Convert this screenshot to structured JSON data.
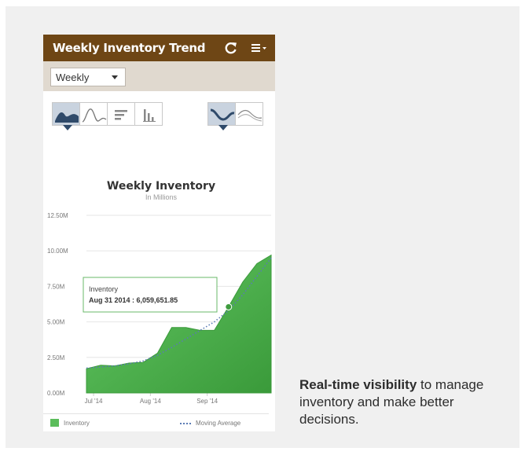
{
  "app": {
    "title": "Weekly Inventory Trend",
    "refresh_icon": "refresh-icon",
    "menu_icon": "hamburger-menu-icon"
  },
  "filter": {
    "selected": "Weekly"
  },
  "chart_types": [
    "area-chart-icon",
    "line-chart-icon",
    "horizontal-bar-chart-icon",
    "column-chart-icon"
  ],
  "chart_modes": [
    "filled-trend-icon",
    "line-trend-icon"
  ],
  "colors": {
    "header": "#6e4615",
    "filterbar": "#e0d9cf",
    "area_top": "#5fc35f",
    "area_bottom": "#3a9a3a",
    "moving_average": "#5a7bb5"
  },
  "chart_data": {
    "type": "area",
    "title": "Weekly Inventory",
    "subtitle": "In Millions",
    "ylim": [
      0,
      12500000
    ],
    "y_ticks": [
      "0.00M",
      "2.50M",
      "5.00M",
      "7.50M",
      "10.00M",
      "12.50M"
    ],
    "x_ticks": [
      "Jul '14",
      "Aug '14",
      "Sep '14"
    ],
    "x_tick_positions": [
      0.5,
      4.5,
      8.5
    ],
    "series": [
      {
        "name": "Inventory",
        "values": [
          1700000,
          1950000,
          1900000,
          2100000,
          2150000,
          2800000,
          4600000,
          4600000,
          4400000,
          4400000,
          6059651.85,
          7800000,
          9100000,
          9700000
        ]
      },
      {
        "name": "Moving Average",
        "values": [
          1750000,
          1820000,
          1900000,
          2050000,
          2250000,
          2650000,
          3200000,
          3800000,
          4400000,
          5000000,
          5800000,
          6900000,
          8200000,
          9500000
        ]
      }
    ],
    "tooltip": {
      "series": "Inventory",
      "text": "Aug 31 2014 : 6,059,651.85",
      "index": 10
    },
    "legend": [
      "Inventory",
      "Moving Average"
    ],
    "grid": true
  },
  "caption": {
    "bold": "Real-time visibility",
    "rest": " to manage inventory and make better decisions."
  }
}
